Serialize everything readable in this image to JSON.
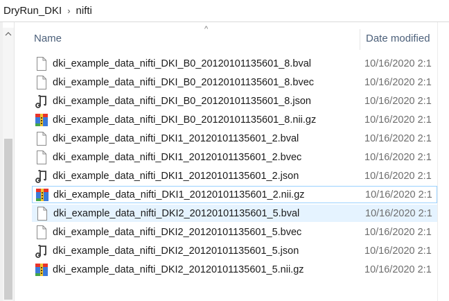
{
  "breadcrumb": {
    "items": [
      "DryRun_DKI",
      "nifti"
    ],
    "separator": "›"
  },
  "nav_pane": {
    "scroll_up_icon": "chevron-up-icon"
  },
  "columns": {
    "sort_indicator": "^",
    "name": "Name",
    "date_modified": "Date modified"
  },
  "files": [
    {
      "name": "dki_example_data_nifti_DKI_B0_20120101135601_8.bval",
      "date": "10/16/2020 2:1",
      "icon": "blank-file-icon"
    },
    {
      "name": "dki_example_data_nifti_DKI_B0_20120101135601_8.bvec",
      "date": "10/16/2020 2:1",
      "icon": "blank-file-icon"
    },
    {
      "name": "dki_example_data_nifti_DKI_B0_20120101135601_8.json",
      "date": "10/16/2020 2:1",
      "icon": "json-file-icon"
    },
    {
      "name": "dki_example_data_nifti_DKI_B0_20120101135601_8.nii.gz",
      "date": "10/16/2020 2:1",
      "icon": "archive-file-icon"
    },
    {
      "name": "dki_example_data_nifti_DKI1_20120101135601_2.bval",
      "date": "10/16/2020 2:1",
      "icon": "blank-file-icon"
    },
    {
      "name": "dki_example_data_nifti_DKI1_20120101135601_2.bvec",
      "date": "10/16/2020 2:1",
      "icon": "blank-file-icon"
    },
    {
      "name": "dki_example_data_nifti_DKI1_20120101135601_2.json",
      "date": "10/16/2020 2:1",
      "icon": "json-file-icon"
    },
    {
      "name": "dki_example_data_nifti_DKI1_20120101135601_2.nii.gz",
      "date": "10/16/2020 2:1",
      "icon": "archive-file-icon"
    },
    {
      "name": "dki_example_data_nifti_DKI2_20120101135601_5.bval",
      "date": "10/16/2020 2:1",
      "icon": "blank-file-icon"
    },
    {
      "name": "dki_example_data_nifti_DKI2_20120101135601_5.bvec",
      "date": "10/16/2020 2:1",
      "icon": "blank-file-icon"
    },
    {
      "name": "dki_example_data_nifti_DKI2_20120101135601_5.json",
      "date": "10/16/2020 2:1",
      "icon": "json-file-icon"
    },
    {
      "name": "dki_example_data_nifti_DKI2_20120101135601_5.nii.gz",
      "date": "10/16/2020 2:1",
      "icon": "archive-file-icon"
    }
  ],
  "focused_index": 7,
  "selected_index": 8,
  "colors": {
    "header_text": "#4c607a",
    "selection_bg": "#e5f3ff",
    "focus_border": "#99d1ff"
  }
}
